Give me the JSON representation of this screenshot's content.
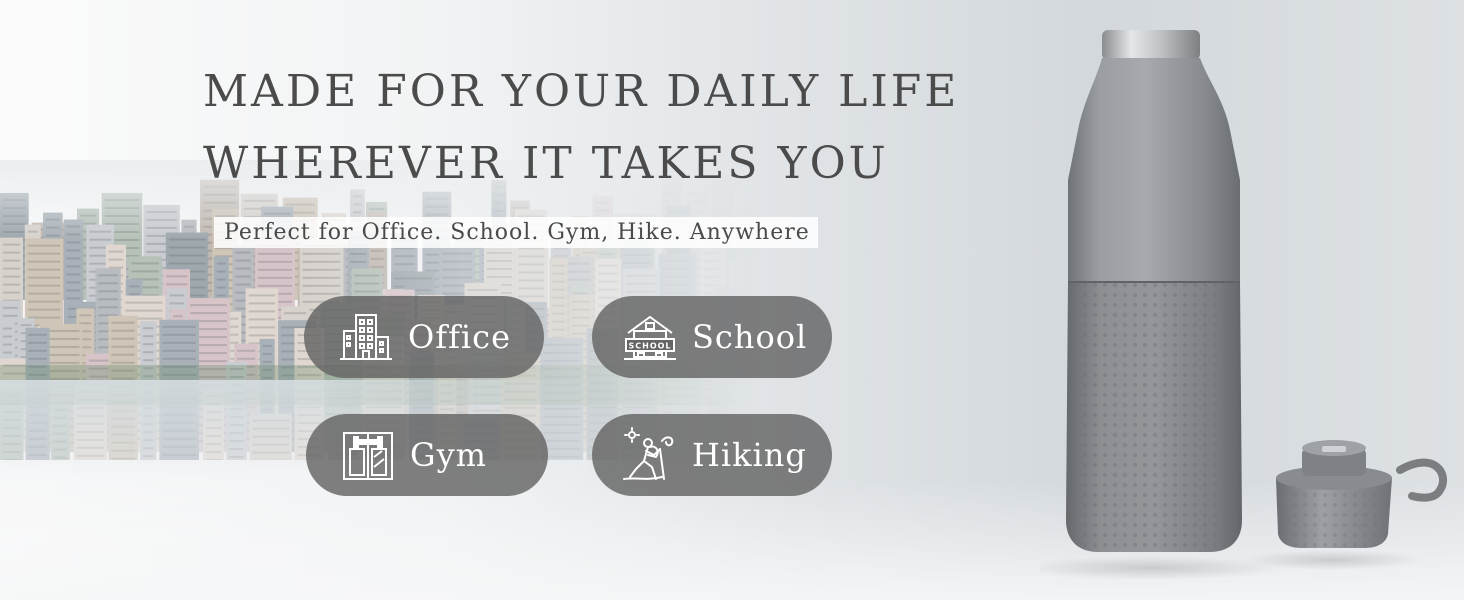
{
  "headline": {
    "line1": "MADE FOR YOUR DAILY LIFE",
    "line2": "WHEREVER IT TAKES YOU"
  },
  "subtitle": "Perfect for Office. School. Gym, Hike. Anywhere",
  "uses": [
    {
      "label": "Office",
      "icon": "office-building-icon"
    },
    {
      "label": "School",
      "icon": "school-building-icon"
    },
    {
      "label": "Gym",
      "icon": "gym-dumbbell-icon"
    },
    {
      "label": "Hiking",
      "icon": "hiker-icon"
    }
  ],
  "school_sign_text": "SCHOOL",
  "colors": {
    "headline_text": "#4b4b4b",
    "pill_bg": "#646464",
    "bottle_body": "#8d9195",
    "bottle_sleeve": "#7e8286"
  }
}
